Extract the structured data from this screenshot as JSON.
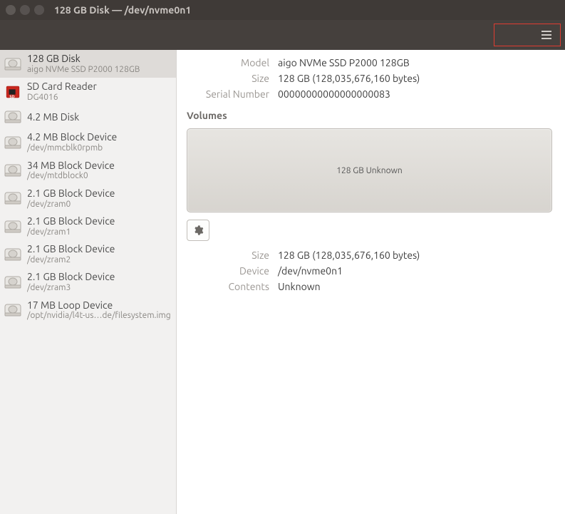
{
  "window": {
    "title": "128 GB Disk — /dev/nvme0n1"
  },
  "devices": [
    {
      "name": "128 GB Disk",
      "sub": "aigo NVMe SSD P2000 128GB",
      "icon": "drive",
      "selected": true
    },
    {
      "name": "SD Card Reader",
      "sub": "DG4016",
      "icon": "sd",
      "selected": false
    },
    {
      "name": "4.2 MB Disk",
      "sub": "",
      "icon": "drive",
      "selected": false
    },
    {
      "name": "4.2 MB Block Device",
      "sub": "/dev/mmcblk0rpmb",
      "icon": "drive",
      "selected": false
    },
    {
      "name": "34 MB Block Device",
      "sub": "/dev/mtdblock0",
      "icon": "drive",
      "selected": false
    },
    {
      "name": "2.1 GB Block Device",
      "sub": "/dev/zram0",
      "icon": "drive",
      "selected": false
    },
    {
      "name": "2.1 GB Block Device",
      "sub": "/dev/zram1",
      "icon": "drive",
      "selected": false
    },
    {
      "name": "2.1 GB Block Device",
      "sub": "/dev/zram2",
      "icon": "drive",
      "selected": false
    },
    {
      "name": "2.1 GB Block Device",
      "sub": "/dev/zram3",
      "icon": "drive",
      "selected": false
    },
    {
      "name": "17 MB Loop Device",
      "sub": "/opt/nvidia/l4t-us…de/filesystem.img",
      "icon": "drive",
      "selected": false
    }
  ],
  "detail": {
    "labels": {
      "model": "Model",
      "size": "Size",
      "serial": "Serial Number"
    },
    "model": "aigo NVMe SSD P2000 128GB",
    "size": "128 GB (128,035,676,160 bytes)",
    "serial": "00000000000000000083"
  },
  "volumes": {
    "heading": "Volumes",
    "block_label": "128 GB Unknown",
    "labels": {
      "size": "Size",
      "device": "Device",
      "contents": "Contents"
    },
    "size": "128 GB (128,035,676,160 bytes)",
    "device": "/dev/nvme0n1",
    "contents": "Unknown"
  }
}
